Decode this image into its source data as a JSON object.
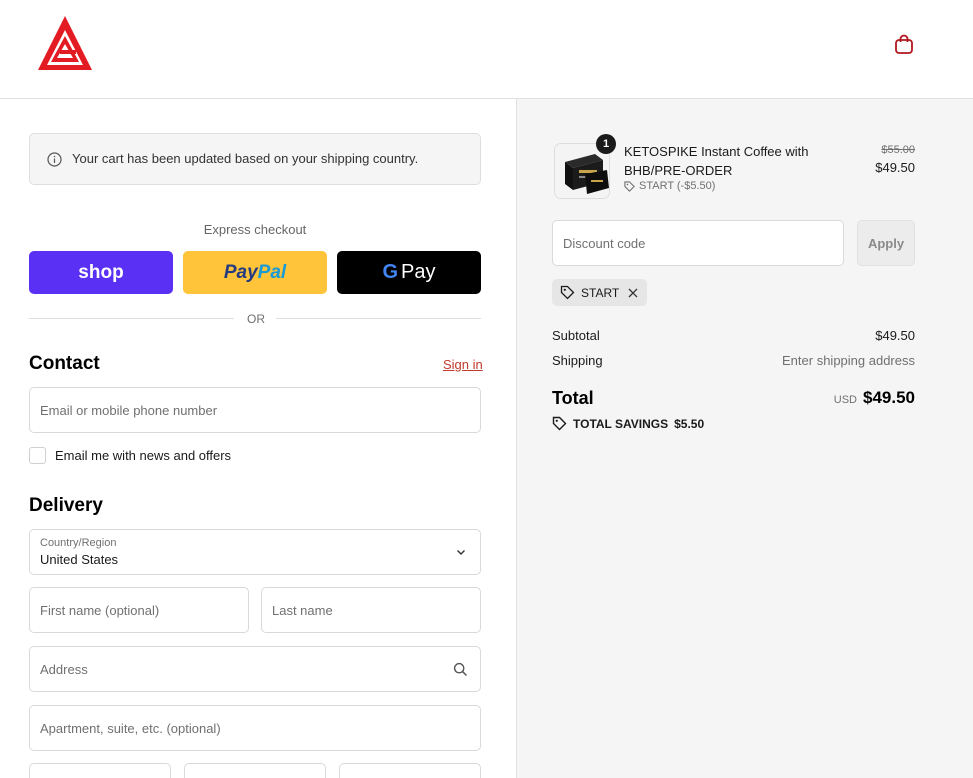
{
  "header": {
    "cart_icon": "shopping-bag-icon",
    "logo_icon": "brand-triangle-logo"
  },
  "notice": {
    "text": "Your cart has been updated based on your shipping country."
  },
  "express": {
    "label": "Express checkout",
    "shop": "shop",
    "paypal_a": "Pay",
    "paypal_b": "Pal",
    "gpay_g": "G",
    "gpay_text": "Pay",
    "or": "OR"
  },
  "contact": {
    "title": "Contact",
    "signin": "Sign in",
    "email_placeholder": "Email or mobile phone number",
    "newsletter_label": "Email me with news and offers"
  },
  "delivery": {
    "title": "Delivery",
    "country_label": "Country/Region",
    "country_value": "United States",
    "first_name_placeholder": "First name (optional)",
    "last_name_placeholder": "Last name",
    "address_placeholder": "Address",
    "apartment_placeholder": "Apartment, suite, etc. (optional)"
  },
  "order": {
    "item": {
      "quantity": "1",
      "name": "KETOSPIKE Instant Coffee with BHB/PRE-ORDER",
      "discount": "START (-$5.50)",
      "old_price": "$55.00",
      "price": "$49.50"
    },
    "discount_placeholder": "Discount code",
    "apply": "Apply",
    "applied_code": "START",
    "subtotal_label": "Subtotal",
    "subtotal_value": "$49.50",
    "shipping_label": "Shipping",
    "shipping_value": "Enter shipping address",
    "total_label": "Total",
    "total_currency": "USD",
    "total_value": "$49.50",
    "savings_label": "TOTAL SAVINGS",
    "savings_value": "$5.50"
  },
  "colors": {
    "brand_red": "#e31b23",
    "shop_purple": "#5a31f4",
    "paypal_yellow": "#ffc439",
    "link_red": "#c0392b"
  }
}
